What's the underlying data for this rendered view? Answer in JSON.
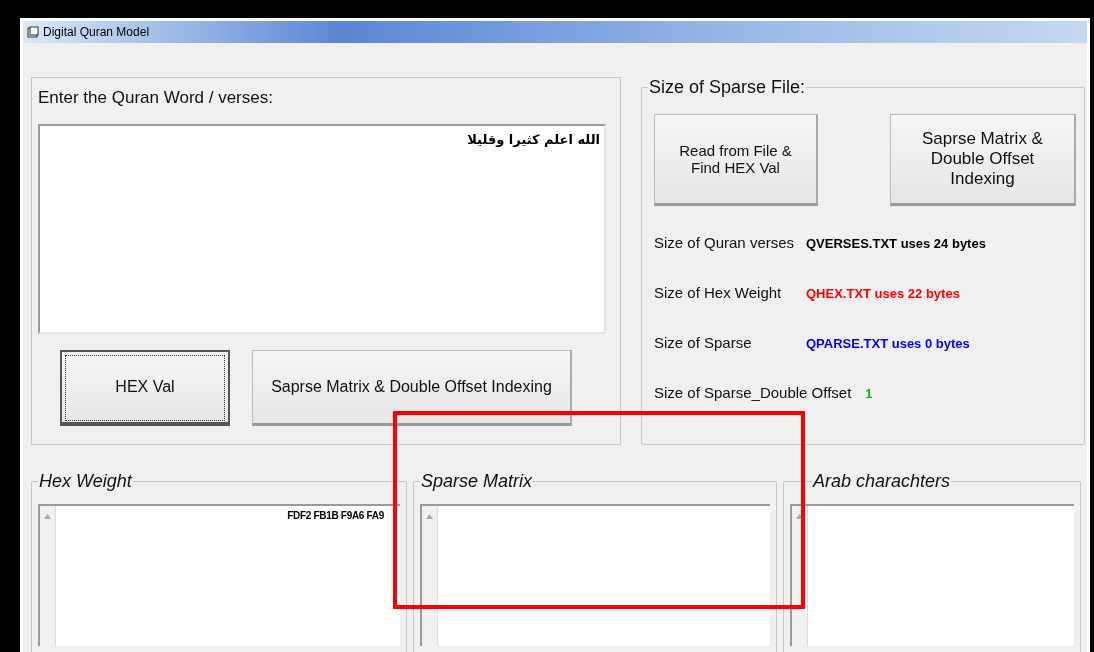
{
  "window": {
    "title": "Digital Quran Model"
  },
  "input_group": {
    "label": "Enter the Quran Word / verses:",
    "text_value": "الله اعلم كثيرا وقليلا",
    "buttons": [
      {
        "label": "HEX Val",
        "focused": true
      },
      {
        "label": "Saprse Matrix & Double Offset Indexing",
        "focused": false
      }
    ]
  },
  "sparse_file_group": {
    "title": "Size of Sparse File:",
    "buttons": [
      {
        "label": "Read from File & Find HEX Val"
      },
      {
        "label": "Saprse Matrix & Double Offset Indexing"
      }
    ],
    "sizes": [
      {
        "label": "Size of Quran verses",
        "value": "QVERSES.TXT uses 24 bytes",
        "color": "#000000"
      },
      {
        "label": "Size of Hex Weight",
        "value": "QHEX.TXT uses 22 bytes",
        "color": "#ff0000"
      },
      {
        "label": "Size of Sparse",
        "value": "QPARSE.TXT uses 0 bytes",
        "color": "#0000ff"
      },
      {
        "label": "Size of Sparse_Double Offset",
        "value": "1",
        "color": "#00c000"
      }
    ]
  },
  "output_groups": [
    {
      "title": "Hex Weight",
      "value": "FDF2 FB1B F9A6 FA9"
    },
    {
      "title": "Sparse Matrix"
    },
    {
      "title": "Arab charachters"
    }
  ],
  "highlight": {
    "kind": "rectangle"
  }
}
